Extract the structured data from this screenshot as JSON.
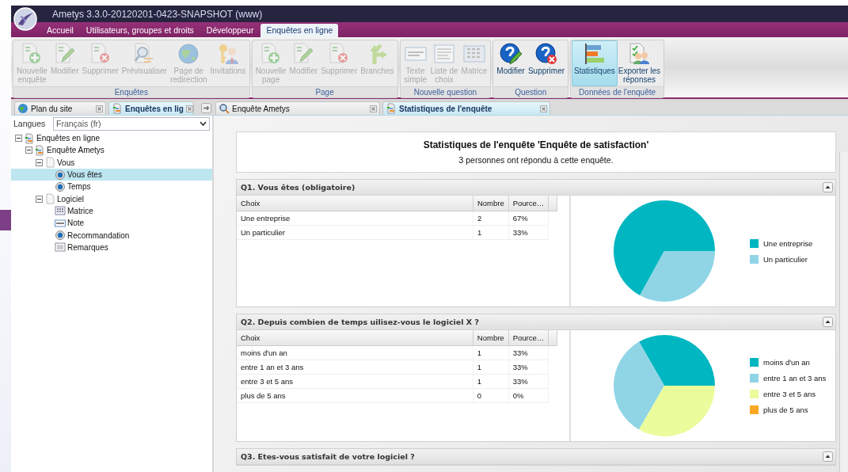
{
  "window": {
    "title": "Ametys 3.3.0-20120201-0423-SNAPSHOT (www)"
  },
  "ribbon_tabs": [
    {
      "label": "Accueil",
      "selected": false
    },
    {
      "label": "Utilisateurs, groupes et droits",
      "selected": false
    },
    {
      "label": "Développeur",
      "selected": false
    },
    {
      "label": "Enquêtes en ligne",
      "selected": true
    }
  ],
  "ribbon_groups": [
    {
      "title": "Enquêtes",
      "buttons": [
        {
          "label": "Nouvelle\nenquête",
          "kind": "add",
          "disabled": true,
          "selected": false
        },
        {
          "label": "Modifier",
          "kind": "edit",
          "disabled": true,
          "selected": false
        },
        {
          "label": "Supprimer",
          "kind": "delete",
          "disabled": true,
          "selected": false
        },
        {
          "label": "Prévisualiser",
          "kind": "preview",
          "disabled": true,
          "selected": false
        },
        {
          "label": "Page de\nredirection",
          "kind": "globe",
          "disabled": true,
          "selected": false
        },
        {
          "label": "Invitations",
          "kind": "keys",
          "disabled": true,
          "selected": false
        }
      ]
    },
    {
      "title": "Page",
      "buttons": [
        {
          "label": "Nouvelle\npage",
          "kind": "add",
          "disabled": true,
          "selected": false
        },
        {
          "label": "Modifier",
          "kind": "edit",
          "disabled": true,
          "selected": false
        },
        {
          "label": "Supprimer",
          "kind": "delete",
          "disabled": true,
          "selected": false
        },
        {
          "label": "Branches",
          "kind": "branch",
          "disabled": true,
          "selected": false
        }
      ]
    },
    {
      "title": "Nouvelle question",
      "buttons": [
        {
          "label": "Texte\nsimple",
          "kind": "text",
          "disabled": true,
          "selected": false
        },
        {
          "label": "Liste de\nchoix",
          "kind": "list",
          "disabled": true,
          "selected": false
        },
        {
          "label": "Matrice",
          "kind": "matrix",
          "disabled": true,
          "selected": false
        }
      ]
    },
    {
      "title": "Question",
      "buttons": [
        {
          "label": "Modifier",
          "kind": "help-edit",
          "disabled": false,
          "selected": false
        },
        {
          "label": "Supprimer",
          "kind": "help-delete",
          "disabled": false,
          "selected": false
        }
      ]
    },
    {
      "title": "Données de l'enquête",
      "buttons": [
        {
          "label": "Statistiques",
          "kind": "chart",
          "disabled": false,
          "selected": true
        },
        {
          "label": "Exporter les\nréponses",
          "kind": "export",
          "disabled": false,
          "selected": false
        }
      ]
    }
  ],
  "left_panel": {
    "tabs": [
      {
        "label": "Plan du site",
        "kind": "globe",
        "selected": false
      },
      {
        "label": "Enquêtes en lig",
        "kind": "survey",
        "selected": true
      }
    ],
    "language": {
      "label": "Langues",
      "value": "Français (fr)"
    },
    "tree": [
      {
        "label": "Enquêtes en ligne",
        "kind": "survey",
        "expanded": true,
        "selected": false,
        "children": [
          {
            "label": "Enquête Ametys",
            "kind": "survey",
            "expanded": true,
            "selected": false,
            "children": [
              {
                "label": "Vous",
                "kind": "page",
                "expanded": true,
                "selected": false,
                "children": [
                  {
                    "label": "Vous êtes",
                    "kind": "radio",
                    "selected": true
                  },
                  {
                    "label": "Temps",
                    "kind": "radio",
                    "selected": false
                  }
                ]
              },
              {
                "label": "Logiciel",
                "kind": "page",
                "expanded": true,
                "selected": false,
                "children": [
                  {
                    "label": "Matrice",
                    "kind": "matrix",
                    "selected": false
                  },
                  {
                    "label": "Note",
                    "kind": "text",
                    "selected": false
                  },
                  {
                    "label": "Recommandation",
                    "kind": "radio",
                    "selected": false
                  },
                  {
                    "label": "Remarques",
                    "kind": "grid",
                    "selected": false
                  }
                ]
              }
            ]
          }
        ]
      }
    ]
  },
  "main_tabs": [
    {
      "label": "Enquête Ametys",
      "kind": "search",
      "selected": false
    },
    {
      "label": "Statistiques de l'enquête",
      "kind": "survey",
      "selected": true
    }
  ],
  "stats": {
    "title": "Statistiques de l'enquête 'Enquête de satisfaction'",
    "subtitle": "3 personnes ont répondu à cette enquête."
  },
  "questions": [
    {
      "title": "Q1. Vous êtes (obligatoire)",
      "columns": [
        "Choix",
        "Nombre",
        "Pource…"
      ],
      "rows": [
        [
          "Une entreprise",
          "2",
          "67%"
        ],
        [
          "Un particulier",
          "1",
          "33%"
        ]
      ],
      "chart_data": {
        "type": "pie",
        "categories": [
          "Une entreprise",
          "Un particulier"
        ],
        "values": [
          67,
          33
        ],
        "colors": [
          "#00b6c1",
          "#8fd5e6"
        ],
        "legend": "right"
      }
    },
    {
      "title": "Q2. Depuis combien de temps uilisez-vous le logiciel X ?",
      "columns": [
        "Choix",
        "Nombre",
        "Pource…"
      ],
      "rows": [
        [
          "moins d'un an",
          "1",
          "33%"
        ],
        [
          "entre 1 an et 3 ans",
          "1",
          "33%"
        ],
        [
          "entre 3 et 5 ans",
          "1",
          "33%"
        ],
        [
          "plus de 5 ans",
          "0",
          "0%"
        ]
      ],
      "chart_data": {
        "type": "pie",
        "categories": [
          "moins d'un an",
          "entre 1 an et 3 ans",
          "entre 3 et 5 ans",
          "plus de 5 ans"
        ],
        "values": [
          33,
          33,
          33,
          0
        ],
        "colors": [
          "#00b6c1",
          "#8fd5e6",
          "#eafc9b",
          "#f9a825"
        ],
        "legend": "right"
      }
    },
    {
      "title": "Q3. Etes-vous satisfait de votre logiciel ?"
    }
  ]
}
